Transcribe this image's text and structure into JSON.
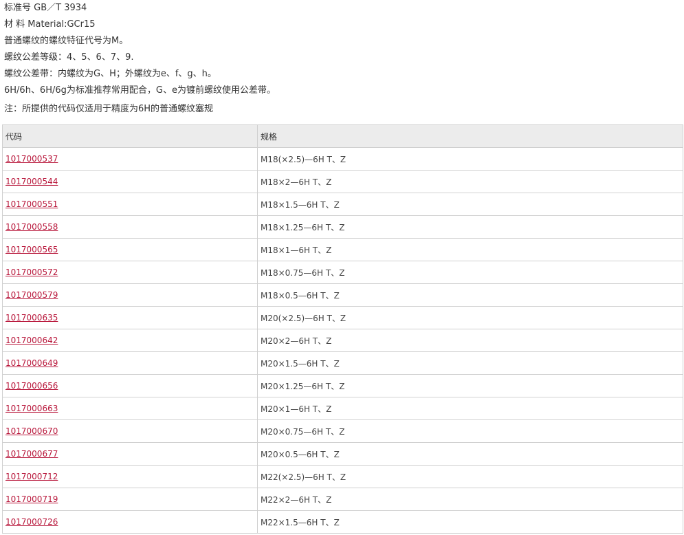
{
  "intro": {
    "lines": [
      "标准号 GB／T 3934",
      "材 料 Material:GCr15",
      "普通螺纹的螺纹特征代号为M。",
      "螺纹公差等级：4、5、6、7、9.",
      "螺纹公差带：内螺纹为G、H；外螺纹为e、f、g、h。",
      "6H/6h、6H/6g为标准推荐常用配合，G、e为镀前螺纹使用公差带。",
      "注：所提供的代码仅适用于精度为6H的普通螺纹塞规"
    ]
  },
  "table": {
    "headers": [
      "代码",
      "规格"
    ],
    "rows": [
      {
        "code": "1017000537",
        "spec": "M18(×2.5)—6H T、Z"
      },
      {
        "code": "1017000544",
        "spec": "M18×2—6H T、Z"
      },
      {
        "code": "1017000551",
        "spec": "M18×1.5—6H T、Z"
      },
      {
        "code": "1017000558",
        "spec": "M18×1.25—6H T、Z"
      },
      {
        "code": "1017000565",
        "spec": "M18×1—6H T、Z"
      },
      {
        "code": "1017000572",
        "spec": "M18×0.75—6H T、Z"
      },
      {
        "code": "1017000579",
        "spec": "M18×0.5—6H T、Z"
      },
      {
        "code": "1017000635",
        "spec": "M20(×2.5)—6H T、Z"
      },
      {
        "code": "1017000642",
        "spec": "M20×2—6H T、Z"
      },
      {
        "code": "1017000649",
        "spec": "M20×1.5—6H T、Z"
      },
      {
        "code": "1017000656",
        "spec": "M20×1.25—6H T、Z"
      },
      {
        "code": "1017000663",
        "spec": "M20×1—6H T、Z"
      },
      {
        "code": "1017000670",
        "spec": "M20×0.75—6H T、Z"
      },
      {
        "code": "1017000677",
        "spec": "M20×0.5—6H T、Z"
      },
      {
        "code": "1017000712",
        "spec": "M22(×2.5)—6H T、Z"
      },
      {
        "code": "1017000719",
        "spec": "M22×2—6H T、Z"
      },
      {
        "code": "1017000726",
        "spec": "M22×1.5—6H T、Z"
      }
    ]
  },
  "colors": {
    "link": "#b8163a",
    "header_bg": "#ececec",
    "border": "#d0d0d0"
  }
}
